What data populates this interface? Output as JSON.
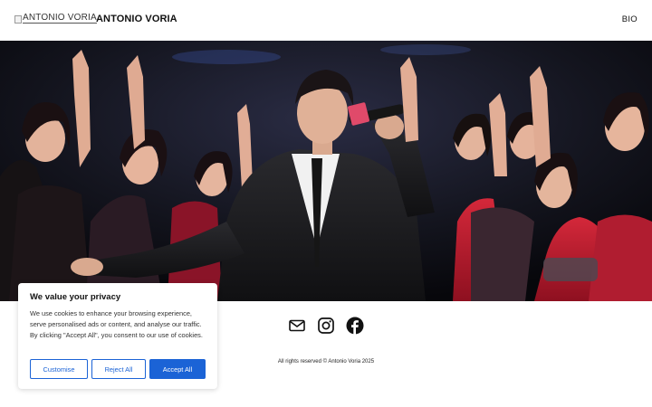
{
  "header": {
    "logo_alt": "ANTONIO VORIA",
    "site_title": "ANTONIO VORIA",
    "nav": [
      {
        "label": "BIO"
      }
    ]
  },
  "hero": {
    "icon": "concert-performance-photo"
  },
  "footer": {
    "social": [
      {
        "name": "email",
        "icon": "envelope-icon"
      },
      {
        "name": "instagram",
        "icon": "instagram-icon"
      },
      {
        "name": "facebook",
        "icon": "facebook-icon"
      }
    ],
    "copyright": "All rights reserved © Antonio Voria 2025"
  },
  "cookie_banner": {
    "title": "We value your privacy",
    "body": "We use cookies to enhance your browsing experience, serve personalised ads or content, and analyse our traffic. By clicking \"Accept All\", you consent to our use of cookies.",
    "customise_label": "Customise",
    "reject_label": "Reject All",
    "accept_label": "Accept All"
  },
  "colors": {
    "accent": "#1b63d6",
    "text": "#111111",
    "background": "#ffffff"
  }
}
